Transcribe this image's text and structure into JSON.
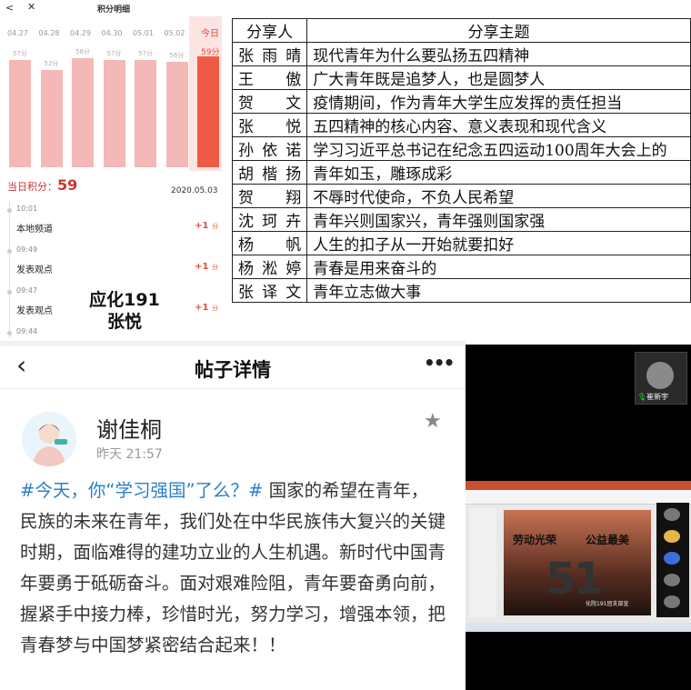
{
  "points_panel": {
    "title": "积分明细",
    "close_icon": "<",
    "x_icon": "✕",
    "days": [
      {
        "date": "04.27",
        "points": "57分",
        "value": 57
      },
      {
        "date": "04.28",
        "points": "52分",
        "value": 52
      },
      {
        "date": "04.29",
        "points": "58分",
        "value": 58
      },
      {
        "date": "04.30",
        "points": "57分",
        "value": 57
      },
      {
        "date": "05.01",
        "points": "57分",
        "value": 57
      },
      {
        "date": "05.02",
        "points": "56分",
        "value": 56
      },
      {
        "date": "今日",
        "points": "59分",
        "value": 59
      }
    ],
    "today_label": "当日积分：",
    "today_points": "59",
    "date": "2020.05.03",
    "events": [
      {
        "time": "10:01",
        "name": "本地频道",
        "gain": "+1",
        "unit": "分"
      },
      {
        "time": "09:49",
        "name": "发表观点",
        "gain": "+1",
        "unit": "分"
      },
      {
        "time": "09:47",
        "name": "发表观点",
        "gain": "+1",
        "unit": "分"
      },
      {
        "time": "09:44",
        "name": "",
        "gain": "",
        "unit": ""
      }
    ],
    "signature_line1": "应化191",
    "signature_line2": "张悦"
  },
  "share_table": {
    "header_sharer": "分享人",
    "header_topic": "分享主题",
    "rows": [
      {
        "name": "张雨晴",
        "topic": "现代青年为什么要弘扬五四精神"
      },
      {
        "name": "王傲",
        "topic": "广大青年既是追梦人，也是圆梦人"
      },
      {
        "name": "贺文",
        "topic": "疫情期间，作为青年大学生应发挥的责任担当"
      },
      {
        "name": "张悦",
        "topic": "五四精神的核心内容、意义表现和现代含义"
      },
      {
        "name": "孙依诺",
        "topic": "学习习近平总书记在纪念五四运动100周年大会上的"
      },
      {
        "name": "胡楷扬",
        "topic": "青年如玉，雕琢成彩"
      },
      {
        "name": "贺翔",
        "topic": "不辱时代使命，不负人民希望"
      },
      {
        "name": "沈珂卉",
        "topic": "青年兴则国家兴，青年强则国家强"
      },
      {
        "name": "杨帆",
        "topic": "人生的扣子从一开始就要扣好"
      },
      {
        "name": "杨淞婷",
        "topic": "青春是用来奋斗的"
      },
      {
        "name": "张译文",
        "topic": "青年立志做大事"
      }
    ]
  },
  "post_panel": {
    "back_icon": "‹",
    "title": "帖子详情",
    "more_icon": "•••",
    "author": "谢佳桐",
    "time": "昨天 21:57",
    "star_icon": "★",
    "tag": "#今天，你“学习强国”了么？#",
    "body": " 国家的希望在青年，民族的未来在青年，我们处在中华民族伟大复兴的关键时期，面临难得的建功立业的人生机遇。新时代中国青年要勇于砥砺奋斗。面对艰难险阻，青年要奋勇向前，握紧手中接力棒，珍惜时光，努力学习，增强本领，把青春梦与中国梦紧密结合起来！！"
  },
  "video_panel": {
    "participant_name": "崔新宇",
    "mic_icon": "🎙",
    "slide_title_left": "劳动光荣",
    "slide_title_right": "公益最美",
    "slide_big": "51",
    "slide_sub": "化院191团支部宣"
  },
  "colors": {
    "accent_red": "#e84a3b",
    "bar_pink": "#f4b9b6",
    "tag_blue": "#2a7fc9"
  }
}
